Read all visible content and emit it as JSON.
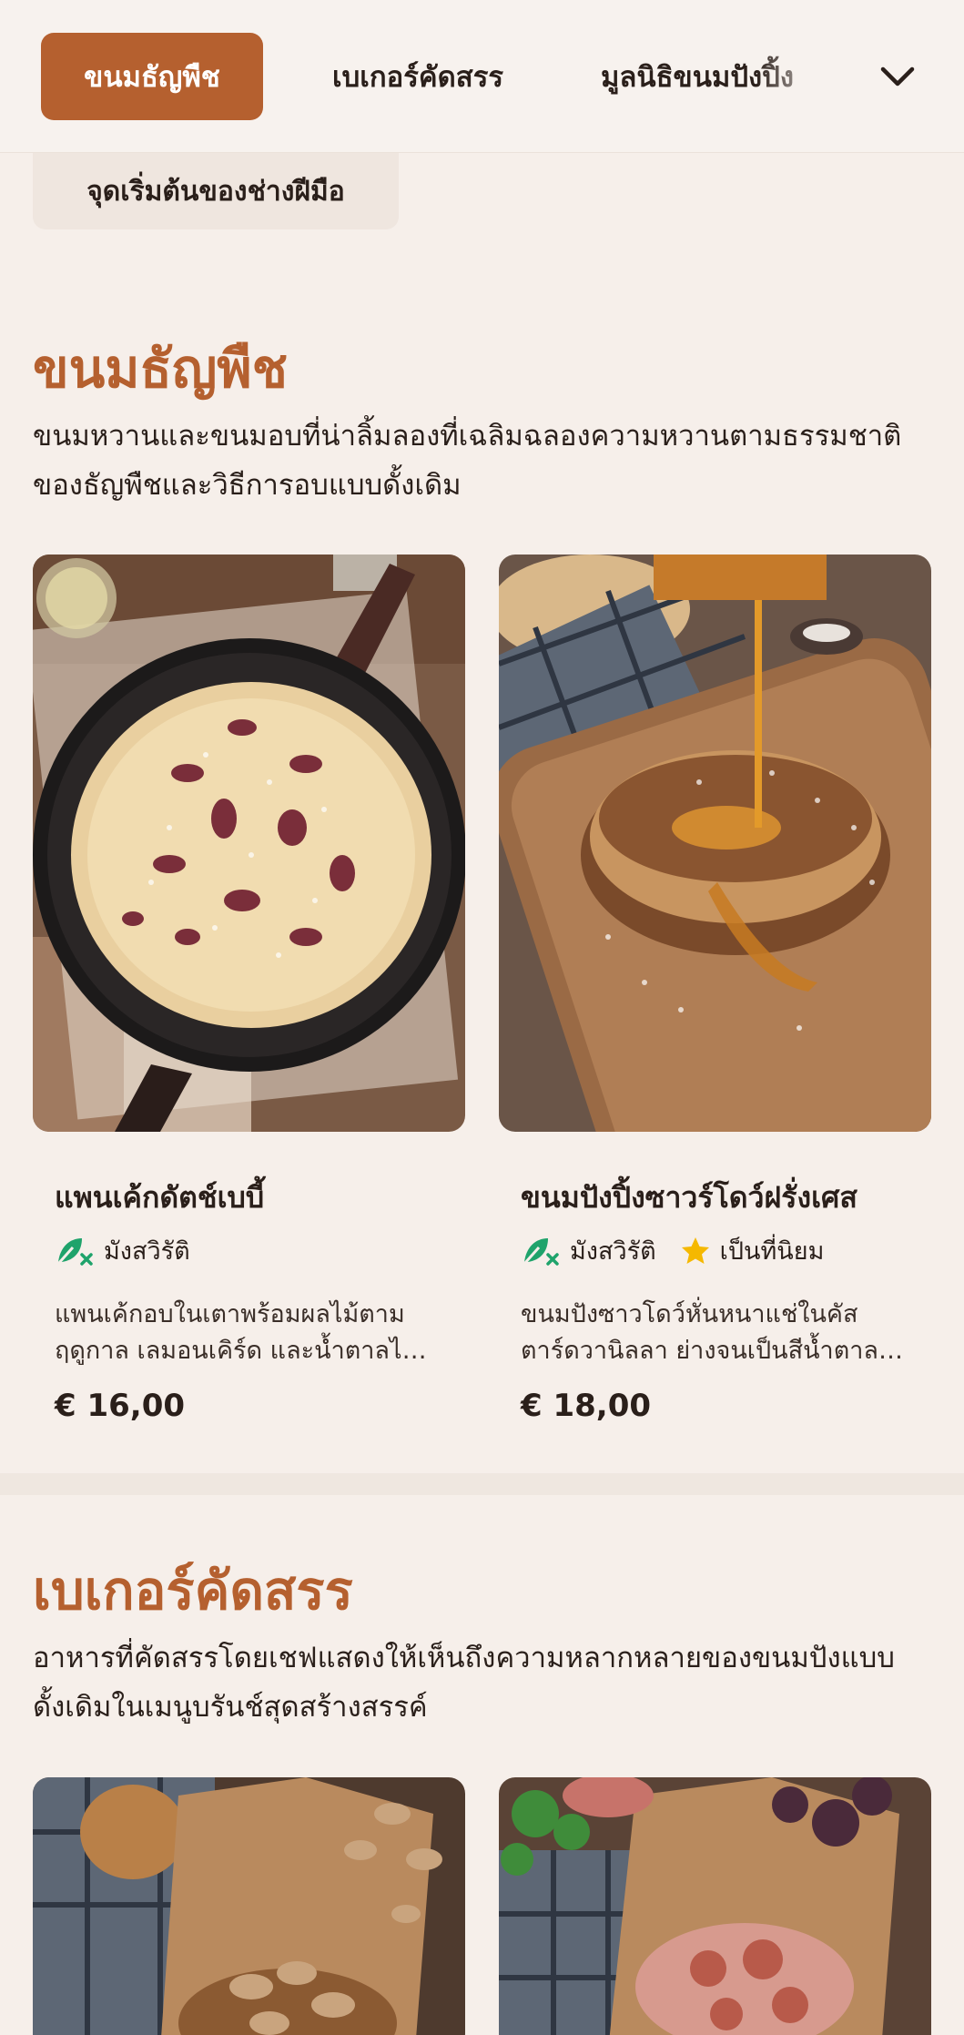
{
  "nav": {
    "tabs": [
      {
        "label": "ขนมธัญพืช",
        "active": true
      },
      {
        "label": "เบเกอร์คัดสรร",
        "active": false
      },
      {
        "label": "มูลนิธิขนมปังปิ้ง",
        "active": false
      }
    ],
    "expand_icon": "chevron-down-icon",
    "subtab_label": "จุดเริ่มต้นของช่างฝีมือ"
  },
  "sections": [
    {
      "title": "ขนมธัญพืช",
      "description": "ขนมหวานและขนมอบที่น่าลิ้มลองที่เฉลิมฉลองความหวานตามธรรมชาติของธัญพืชและวิธีการอบแบบดั้งเดิม",
      "items": [
        {
          "name": "แพนเค้กดัตช์เบบี้",
          "tags": [
            {
              "label": "มังสวิรัติ",
              "icon": "vegetarian-icon"
            }
          ],
          "description": "แพนเค้กอบในเตาพร้อมผลไม้ตามฤดูกาล เลมอนเคิร์ด และน้ำตาลไอซิ่ง",
          "price": "€ 16,00"
        },
        {
          "name": "ขนมปังปิ้งซาวร์โดว์ฝรั่งเศส",
          "tags": [
            {
              "label": "มังสวิรัติ",
              "icon": "vegetarian-icon"
            },
            {
              "label": "เป็นที่นิยม",
              "icon": "star-icon"
            }
          ],
          "description": "ขนมปังซาวโดว์หั่นหนาแช่ในคัสตาร์ดวานิลลา ย่างจนเป็นสีน้ำตาลทอง",
          "price": "€ 18,00"
        }
      ]
    },
    {
      "title": "เบเกอร์คัดสรร",
      "description": "อาหารที่คัดสรรโดยเชฟแสดงให้เห็นถึงความหลากหลายของขนมปังแบบดั้งเดิมในเมนูบรันช์สุดสร้างสรรค์"
    }
  ],
  "colors": {
    "accent": "#b5602f",
    "background": "#f6efea",
    "vegetarian_icon": "#1fa36b",
    "star_icon": "#f5b800"
  }
}
